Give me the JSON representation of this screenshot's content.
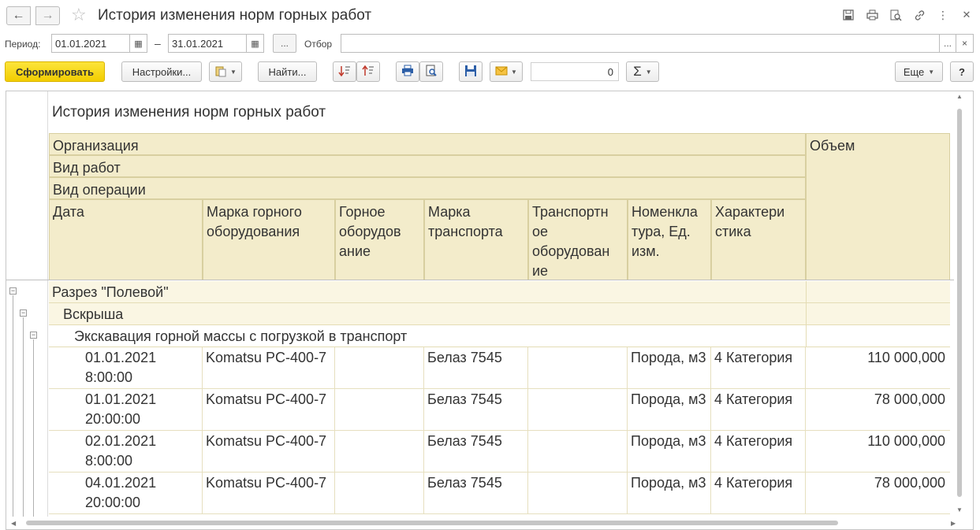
{
  "window": {
    "title": "История изменения норм горных работ"
  },
  "period": {
    "label": "Период:",
    "from": "01.01.2021",
    "dash": "–",
    "to": "31.01.2021",
    "more": "...",
    "filter_label": "Отбор",
    "filter_value": "",
    "filter_more": "...",
    "filter_clear": "×"
  },
  "toolbar": {
    "generate": "Сформировать",
    "settings": "Настройки...",
    "find": "Найти...",
    "sum_value": "0",
    "sigma": "Σ",
    "more": "Еще",
    "help": "?"
  },
  "icons": {
    "back": "arrow-left-icon",
    "forward": "arrow-right-icon",
    "favorite": "star-icon",
    "save": "floppy-icon",
    "print": "printer-icon",
    "preview": "preview-icon",
    "link": "link-icon",
    "menu": "kebab-icon",
    "close": "close-icon"
  },
  "report": {
    "title": "История изменения норм горных работ",
    "headers": {
      "org": "Организация",
      "work_type": "Вид работ",
      "operation": "Вид операции",
      "volume": "Объем",
      "columns": [
        "Дата",
        "Марка горного оборудования",
        "Горное оборудов ание",
        "Марка транспорта",
        "Транспортн ое оборудован ие",
        "Номенкла тура, Ед. изм.",
        "Характери стика"
      ]
    },
    "group_org": "Разрез \"Полевой\"",
    "group_work": "Вскрыша",
    "group_operation": "Экскавация горной массы с погрузкой в транспорт",
    "rows": [
      {
        "date": "01.01.2021 8:00:00",
        "mark": "Komatsu PC-400-7",
        "equip": "",
        "transport_mark": "Белаз 7545",
        "transport": "",
        "nom": "Порода, м3",
        "char": "4 Категория",
        "volume": "110 000,000"
      },
      {
        "date": "01.01.2021 20:00:00",
        "mark": "Komatsu PC-400-7",
        "equip": "",
        "transport_mark": "Белаз 7545",
        "transport": "",
        "nom": "Порода, м3",
        "char": "4 Категория",
        "volume": "78 000,000"
      },
      {
        "date": "02.01.2021 8:00:00",
        "mark": "Komatsu PC-400-7",
        "equip": "",
        "transport_mark": "Белаз 7545",
        "transport": "",
        "nom": "Порода, м3",
        "char": "4 Категория",
        "volume": "110 000,000"
      },
      {
        "date": "04.01.2021 20:00:00",
        "mark": "Komatsu PC-400-7",
        "equip": "",
        "transport_mark": "Белаз 7545",
        "transport": "",
        "nom": "Порода, м3",
        "char": "4 Категория",
        "volume": "78 000,000"
      }
    ]
  }
}
